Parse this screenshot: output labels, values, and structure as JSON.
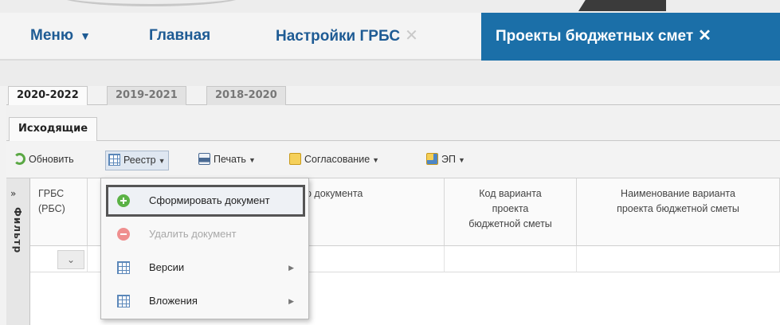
{
  "nav": {
    "menu": "Меню",
    "main": "Главная",
    "settings": "Настройки ГРБС",
    "active": "Проекты бюджетных смет"
  },
  "year_tabs": [
    "2020-2022",
    "2019-2021",
    "2018-2020"
  ],
  "subtab": "Исходящие",
  "toolbar": {
    "refresh": "Обновить",
    "registry": "Реестр",
    "print": "Печать",
    "approval": "Согласование",
    "ep": "ЭП"
  },
  "filter_panel": {
    "label": "Фильтр",
    "expand": "»"
  },
  "columns": {
    "grbs_line1": "ГРБС",
    "grbs_line2": "(РБС)",
    "doc_number_partial": "р документа",
    "variant_code": [
      "Код варианта",
      "проекта",
      "бюджетной сметы"
    ],
    "variant_name": [
      "Наименование варианта",
      "проекта бюджетной сметы"
    ]
  },
  "context_menu": {
    "create": "Сформировать документ",
    "delete": "Удалить документ",
    "versions": "Версии",
    "attachments": "Вложения"
  },
  "colors": {
    "nav_text": "#1e5b94",
    "nav_active_bg": "#1b6fa8",
    "add_icon": "#5bb245",
    "delete_icon": "#ef8f8f"
  }
}
